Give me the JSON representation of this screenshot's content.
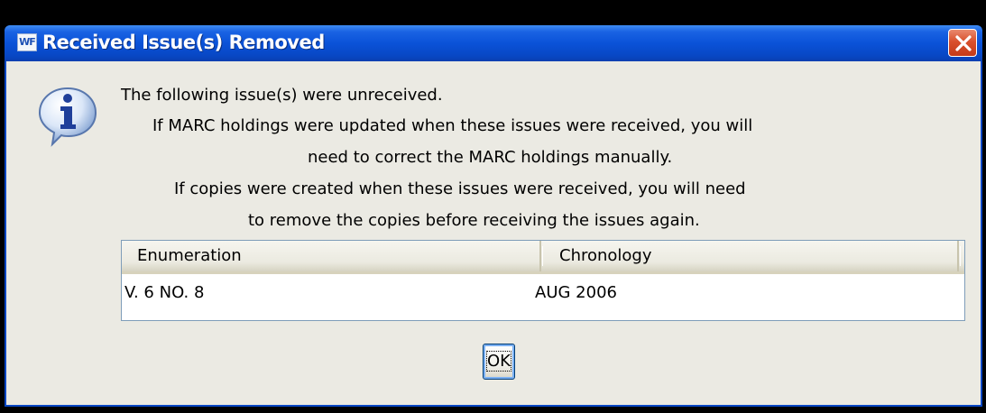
{
  "window": {
    "app_icon_label": "WF",
    "title": "Received Issue(s) Removed"
  },
  "message": {
    "lines": [
      "The following issue(s) were unreceived.",
      "If MARC holdings were updated when these issues were received, you will",
      "need to correct the MARC holdings manually.",
      "If copies were created when these issues were received, you will need",
      "to remove the copies before receiving the issues again."
    ]
  },
  "table": {
    "columns": [
      "Enumeration",
      "Chronology"
    ],
    "rows": [
      {
        "enumeration": "V. 6 NO. 8",
        "chronology": "AUG 2006"
      }
    ]
  },
  "buttons": {
    "ok_label": "OK"
  },
  "icons": {
    "dialog_icon": "info-icon",
    "close_icon": "close-icon",
    "app_icon": "app-icon"
  },
  "colors": {
    "titlebar": "#0a52d8",
    "close_button": "#d9502c",
    "dialog_background": "#ebeae3"
  }
}
